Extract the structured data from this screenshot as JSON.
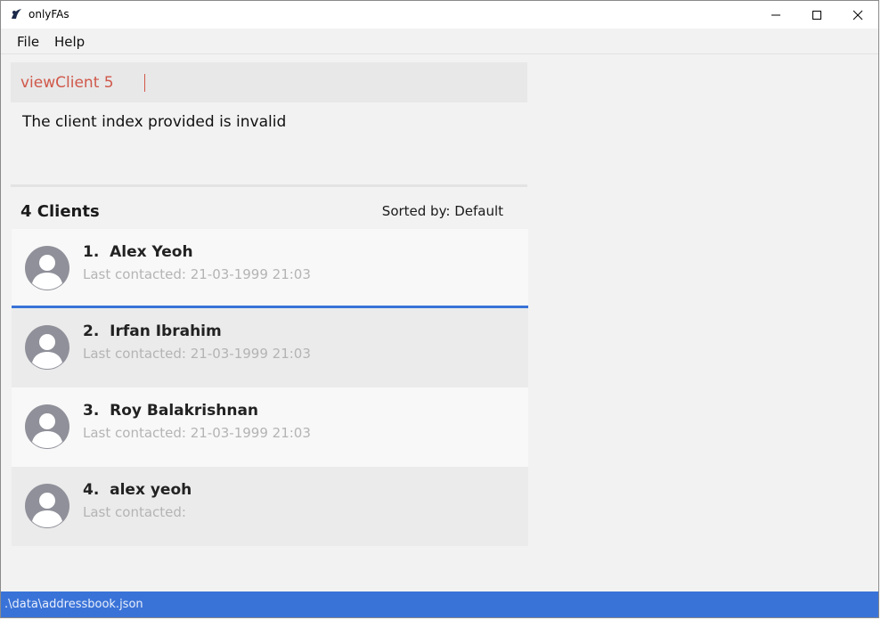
{
  "window": {
    "title": "onlyFAs"
  },
  "menu": {
    "file": "File",
    "help": "Help"
  },
  "command": {
    "value": "viewClient 5",
    "color": "#d0584a"
  },
  "result": {
    "message": "The client index provided is invalid"
  },
  "list": {
    "count_label": "4 Clients",
    "sort_label": "Sorted by: Default",
    "clients": [
      {
        "index_name": "1.  Alex Yeoh",
        "last_contacted": "Last contacted: 21-03-1999 21:03",
        "selected": true
      },
      {
        "index_name": "2.  Irfan Ibrahim",
        "last_contacted": "Last contacted: 21-03-1999 21:03",
        "selected": false
      },
      {
        "index_name": "3.  Roy Balakrishnan",
        "last_contacted": "Last contacted: 21-03-1999 21:03",
        "selected": false
      },
      {
        "index_name": "4.  alex yeoh",
        "last_contacted": "Last contacted:",
        "selected": false
      }
    ]
  },
  "status": {
    "path": ".\\data\\addressbook.json"
  },
  "colors": {
    "accent": "#3a73d8",
    "error_text": "#d0584a"
  },
  "icons": {
    "app": "app-logo-icon",
    "avatar": "user-avatar-icon",
    "minimize": "minimize-icon",
    "maximize": "maximize-icon",
    "close": "close-icon"
  }
}
